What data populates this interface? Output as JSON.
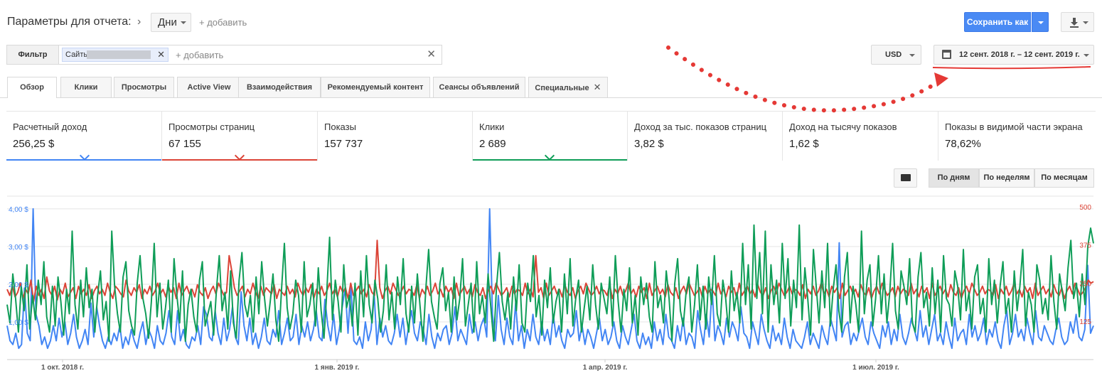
{
  "header": {
    "params_label": "Параметры для отчета:",
    "granularity_value": "Дни",
    "add_label": "+ добавить",
    "save_label": "Сохранить как"
  },
  "filter": {
    "label": "Фильтр",
    "chip_label": "Сайты",
    "add_label": "+ добавить",
    "currency": "USD",
    "date_range": "12 сент. 2018 г. – 12 сент. 2019 г."
  },
  "tabs": [
    {
      "label": "Обзор"
    },
    {
      "label": "Клики"
    },
    {
      "label": "Просмотры"
    },
    {
      "label": "Active View"
    },
    {
      "label": "Взаимодействия"
    },
    {
      "label": "Рекомендуемый контент"
    },
    {
      "label": "Сеансы объявлений"
    },
    {
      "label": "Специальные"
    }
  ],
  "scorecards": [
    {
      "label": "Расчетный доход",
      "value": "256,25 $",
      "color": "#4285f4"
    },
    {
      "label": "Просмотры страниц",
      "value": "67 155",
      "color": "#db4437"
    },
    {
      "label": "Показы",
      "value": "157 737",
      "color": ""
    },
    {
      "label": "Клики",
      "value": "2 689",
      "color": "#0f9d58"
    },
    {
      "label": "Доход за тыс. показов страниц",
      "value": "3,82 $",
      "color": ""
    },
    {
      "label": "Доход на тысячу показов",
      "value": "1,62 $",
      "color": ""
    },
    {
      "label": "Показы в видимой части экрана",
      "value": "78,62%",
      "color": ""
    }
  ],
  "granularity": {
    "day": "По дням",
    "week": "По неделям",
    "month": "По месяцам",
    "selected": "day"
  },
  "chart_data": {
    "type": "line",
    "x_labels": [
      "1 окт. 2018 г.",
      "1 янв. 2019 г.",
      "1 апр. 2019 г.",
      "1 июл. 2019 г."
    ],
    "y_left_ticks": [
      "1,00 $",
      "2,00 $",
      "3,00 $",
      "4,00 $"
    ],
    "y_left_range": [
      0,
      4.3
    ],
    "y_right_ticks": [
      "125",
      "250",
      "375",
      "500"
    ],
    "y_right_range": [
      0,
      530
    ],
    "series": [
      {
        "color": "#4285f4",
        "axis": "left",
        "values": [
          0.9,
          0.5,
          0.4,
          0.7,
          0.3,
          0.4,
          1.9,
          0.7,
          0.5,
          4.0,
          1.2,
          0.9,
          0.4,
          0.6,
          0.3,
          0.5,
          0.9,
          0.5,
          1.1,
          0.6,
          1.0,
          0.4,
          0.7,
          1.2,
          0.6,
          0.3,
          0.5,
          0.8,
          0.4,
          1.5,
          0.6,
          1.4,
          0.9,
          0.5,
          0.3,
          0.6,
          0.4,
          0.7,
          0.5,
          0.9,
          0.3,
          0.6,
          0.4,
          0.8,
          0.5,
          0.3,
          0.7,
          1.0,
          0.4,
          0.8,
          0.6,
          0.3,
          0.9,
          0.5,
          0.4,
          0.7,
          1.3,
          0.6,
          0.4,
          1.3,
          0.5,
          0.8,
          0.4,
          0.3,
          0.6,
          0.5,
          0.9,
          0.4,
          1.4,
          1.2,
          0.6,
          0.5,
          1.3,
          0.7,
          0.4,
          1.1,
          0.5,
          0.8,
          1.4,
          0.6,
          0.4,
          1.8,
          0.9,
          0.5,
          1.1,
          0.4,
          0.7,
          0.3,
          0.6,
          1.1,
          0.5,
          0.4,
          0.8,
          0.6,
          1.3,
          0.4,
          0.7,
          1.1,
          0.5,
          0.6,
          1.2,
          0.4,
          0.9,
          0.6,
          1.0,
          0.5,
          0.8,
          1.3,
          0.6,
          0.5,
          1.6,
          0.9,
          0.5,
          1.2,
          0.4,
          0.8,
          1.4,
          1.9,
          0.7,
          2.0,
          0.5,
          0.4,
          0.6,
          0.3,
          1.0,
          0.5,
          0.8,
          1.8,
          0.4,
          1.1,
          0.6,
          0.9,
          0.5,
          0.4,
          0.7,
          1.2,
          0.6,
          1.1,
          0.4,
          0.9,
          1.3,
          0.7,
          0.5,
          1.0,
          0.8,
          0.4,
          1.2,
          0.6,
          0.3,
          0.7,
          0.5,
          0.8,
          0.9,
          0.4,
          0.7,
          1.4,
          0.5,
          0.8,
          0.6,
          0.4,
          1.2,
          0.7,
          1.0,
          0.5,
          0.9,
          1.1,
          0.6,
          4.0,
          1.2,
          0.5,
          1.7,
          0.8,
          0.4,
          1.1,
          0.6,
          0.4,
          1.5,
          0.5,
          0.9,
          0.3,
          0.8,
          0.5,
          1.2,
          0.6,
          0.4,
          1.0,
          0.5,
          0.8,
          0.4,
          1.2,
          0.6,
          0.9,
          0.5,
          0.3,
          0.8,
          0.6,
          0.7,
          1.3,
          0.5,
          0.9,
          0.4,
          0.8,
          0.6,
          0.3,
          0.7,
          1.1,
          0.5,
          0.8,
          0.4,
          0.6,
          1.0,
          0.5,
          0.3,
          0.9,
          0.6,
          0.4,
          0.8,
          1.2,
          0.5,
          0.3,
          0.7,
          0.4,
          0.6,
          0.3,
          1.0,
          0.5,
          0.8,
          0.4,
          1.2,
          0.6,
          0.5,
          0.3,
          0.9,
          0.5,
          1.1,
          0.4,
          0.7,
          0.6,
          0.3,
          1.3,
          0.8,
          0.4,
          1.2,
          0.6,
          1.9,
          0.5,
          0.9,
          0.7,
          0.4,
          1.1,
          0.6,
          1.0,
          0.8,
          0.5,
          1.4,
          0.7,
          0.6,
          0.3,
          1.0,
          0.7,
          0.4,
          1.2,
          0.8,
          0.5,
          0.3,
          0.9,
          0.5,
          0.7,
          0.4,
          1.1,
          0.6,
          0.3,
          0.8,
          0.5,
          0.4,
          0.3,
          0.6,
          1.0,
          0.4,
          0.7,
          0.5,
          0.3,
          0.9,
          0.6,
          0.4,
          1.1,
          0.8,
          0.5,
          3.1,
          0.6,
          0.9,
          1.0,
          0.4,
          0.7,
          0.5,
          0.8,
          1.1,
          0.6,
          0.4,
          1.0,
          0.7,
          0.5,
          0.3,
          0.9,
          0.6,
          1.0,
          0.4,
          0.8,
          0.5,
          1.2,
          0.6,
          0.4,
          0.7,
          1.1,
          0.8,
          0.5,
          1.3,
          0.6,
          0.9,
          0.4,
          0.8,
          1.2,
          0.5,
          0.7,
          0.4,
          1.0,
          0.6,
          0.3,
          1.1,
          0.5,
          0.7,
          0.8,
          0.4,
          1.2,
          0.6,
          0.9,
          0.5,
          0.7,
          1.1,
          0.4,
          0.8,
          0.6,
          1.0,
          0.5,
          0.3,
          0.9,
          1.3,
          0.4,
          0.7,
          1.2,
          0.6,
          0.8,
          0.5,
          1.1,
          0.7,
          0.4,
          1.3,
          0.6,
          0.5,
          0.9,
          0.7,
          0.5,
          0.4,
          0.8,
          1.1,
          0.6,
          0.4,
          0.5,
          1.0,
          0.7,
          1.2,
          0.6,
          0.5,
          0.8,
          2.5,
          0.7,
          0.9
        ]
      },
      {
        "color": "#db4437",
        "axis": "right",
        "values": [
          230,
          210,
          240,
          205,
          220,
          250,
          200,
          230,
          215,
          260,
          190,
          240,
          210,
          230,
          200,
          270,
          225,
          210,
          240,
          195,
          230,
          215,
          250,
          205,
          220,
          235,
          200,
          240,
          215,
          230,
          210,
          245,
          200,
          225,
          240,
          215,
          230,
          210,
          250,
          220,
          200,
          240,
          230,
          215,
          205,
          260,
          225,
          210,
          235,
          220,
          245,
          200,
          230,
          215,
          240,
          210,
          225,
          250,
          215,
          230,
          205,
          240,
          220,
          235,
          200,
          250,
          210,
          225,
          240,
          215,
          230,
          205,
          245,
          220,
          210,
          235,
          200,
          225,
          240,
          215,
          250,
          230,
          210,
          220,
          340,
          290,
          235,
          210,
          225,
          240,
          205,
          230,
          215,
          250,
          220,
          200,
          240,
          210,
          235,
          225,
          215,
          245,
          200,
          230,
          220,
          210,
          240,
          215,
          230,
          205,
          250,
          225,
          210,
          235,
          220,
          245,
          200,
          230,
          215,
          240,
          210,
          225,
          250,
          215,
          230,
          205,
          240,
          220,
          235,
          200,
          250,
          210,
          225,
          240,
          215,
          230,
          205,
          245,
          220,
          210,
          390,
          235,
          200,
          225,
          240,
          215,
          250,
          230,
          210,
          220,
          240,
          215,
          230,
          225,
          210,
          245,
          200,
          230,
          215,
          240,
          210,
          225,
          250,
          215,
          230,
          205,
          240,
          220,
          235,
          200,
          250,
          210,
          225,
          240,
          215,
          230,
          205,
          245,
          220,
          210,
          235,
          200,
          225,
          240,
          215,
          250,
          230,
          210,
          220,
          235,
          205,
          240,
          215,
          230,
          225,
          210,
          250,
          215,
          230,
          205,
          340,
          220,
          235,
          200,
          250,
          210,
          225,
          240,
          215,
          230,
          205,
          245,
          220,
          210,
          235,
          200,
          225,
          240,
          215,
          250,
          230,
          210,
          220,
          240,
          215,
          230,
          225,
          210,
          245,
          200,
          230,
          215,
          240,
          210,
          225,
          250,
          215,
          230,
          205,
          240,
          220,
          235,
          200,
          250,
          210,
          225,
          240,
          215,
          230,
          205,
          245,
          220,
          210,
          235,
          200,
          225,
          240,
          215,
          250,
          230,
          210,
          220,
          235,
          205,
          240,
          215,
          230,
          225,
          210,
          250,
          215,
          230,
          205,
          240,
          220,
          235,
          200,
          250,
          210,
          225,
          240,
          215,
          230,
          205,
          245,
          220,
          210,
          235,
          200,
          225,
          240,
          215,
          250,
          230,
          210,
          220,
          240,
          215,
          230,
          225,
          210,
          245,
          200,
          230,
          215,
          240,
          210,
          225,
          250,
          215,
          230,
          205,
          240,
          220,
          235,
          200,
          250,
          210,
          225,
          240,
          215,
          230,
          205,
          245,
          220,
          210,
          235,
          200,
          225,
          240,
          215,
          250,
          230,
          210,
          220,
          235,
          205,
          240,
          215,
          230,
          225,
          210,
          250,
          215,
          230,
          205,
          240,
          220,
          235,
          200,
          250,
          210,
          225,
          240,
          215,
          230,
          205,
          245,
          220,
          210,
          235,
          200,
          225,
          240,
          215,
          250,
          230,
          210,
          220,
          240,
          215,
          230,
          225,
          210,
          245,
          200,
          230,
          215,
          240,
          210,
          225,
          250,
          215,
          230,
          205,
          240,
          220,
          235,
          200,
          250,
          210,
          225,
          240,
          215,
          230,
          205,
          245,
          220,
          210,
          235,
          200,
          225,
          240,
          215,
          250,
          230,
          210,
          220,
          235,
          260,
          250,
          255
        ]
      },
      {
        "color": "#0f9d58",
        "axis": "right",
        "values": [
          180,
          120,
          280,
          200,
          90,
          240,
          160,
          310,
          100,
          210,
          130,
          260,
          180,
          320,
          140,
          90,
          240,
          110,
          270,
          190,
          80,
          230,
          150,
          420,
          180,
          100,
          260,
          140,
          300,
          170,
          230,
          90,
          210,
          290,
          130,
          190,
          60,
          420,
          240,
          150,
          90,
          270,
          320,
          160,
          110,
          80,
          250,
          340,
          200,
          150,
          70,
          190,
          380,
          140,
          250,
          100,
          170,
          260,
          90,
          330,
          210,
          120,
          290,
          60,
          180,
          230,
          140,
          90,
          260,
          320,
          110,
          150,
          190,
          80,
          230,
          340,
          160,
          220,
          100,
          290,
          120,
          70,
          260,
          350,
          180,
          140,
          210,
          90,
          270,
          150,
          320,
          200,
          110,
          190,
          280,
          130,
          60,
          230,
          380,
          170,
          100,
          150,
          260,
          210,
          90,
          320,
          140,
          180,
          250,
          110,
          300,
          160,
          70,
          220,
          400,
          130,
          260,
          190,
          90,
          310,
          170,
          210,
          110,
          250,
          80,
          290,
          140,
          340,
          180,
          120,
          260,
          200,
          90,
          160,
          310,
          130,
          220,
          100,
          270,
          180,
          330,
          150,
          90,
          240,
          120,
          280,
          170,
          60,
          230,
          360,
          190,
          140,
          100,
          250,
          300,
          160,
          220,
          90,
          270,
          130,
          200,
          330,
          110,
          180,
          250,
          90,
          320,
          150,
          210,
          120,
          280,
          170,
          60,
          240,
          350,
          190,
          130,
          220,
          100,
          270,
          160,
          310,
          120,
          90,
          250,
          190,
          340,
          140,
          210,
          80,
          260,
          170,
          300,
          120,
          190,
          230,
          90,
          280,
          150,
          330,
          110,
          200,
          260,
          90,
          170,
          240,
          130,
          310,
          180,
          100,
          250,
          200,
          150,
          270,
          110,
          340,
          190,
          90,
          230,
          160,
          300,
          120,
          210,
          80,
          270,
          180,
          250,
          140,
          90,
          320,
          170,
          210,
          120,
          290,
          200,
          60,
          250,
          330,
          160,
          110,
          220,
          270,
          90,
          180,
          310,
          130,
          240,
          100,
          270,
          180,
          340,
          150,
          110,
          260,
          200,
          90,
          290,
          160,
          220,
          120,
          380,
          180,
          310,
          100,
          440,
          200,
          350,
          150,
          420,
          90,
          310,
          180,
          260,
          120,
          380,
          200,
          330,
          110,
          260,
          170,
          440,
          130,
          300,
          200,
          80,
          360,
          240,
          120,
          290,
          170,
          380,
          110,
          230,
          310,
          160,
          90,
          270,
          350,
          120,
          240,
          180,
          90,
          420,
          150,
          260,
          310,
          110,
          200,
          340,
          150,
          280,
          120,
          220,
          380,
          160,
          100,
          290,
          240,
          180,
          330,
          120,
          90,
          270,
          350,
          170,
          220,
          110,
          300,
          150,
          260,
          90,
          340,
          200,
          180,
          110,
          290,
          240,
          130,
          360,
          160,
          220,
          100,
          270,
          310,
          150,
          200,
          90,
          330,
          180,
          260,
          120,
          240,
          320,
          150,
          200,
          90,
          290,
          160,
          240,
          360,
          110,
          220,
          180,
          90,
          310,
          260,
          150,
          200,
          130,
          340,
          190,
          100,
          280,
          220,
          160,
          300,
          390,
          200,
          250,
          140,
          280,
          180,
          370,
          430,
          380
        ]
      }
    ]
  }
}
